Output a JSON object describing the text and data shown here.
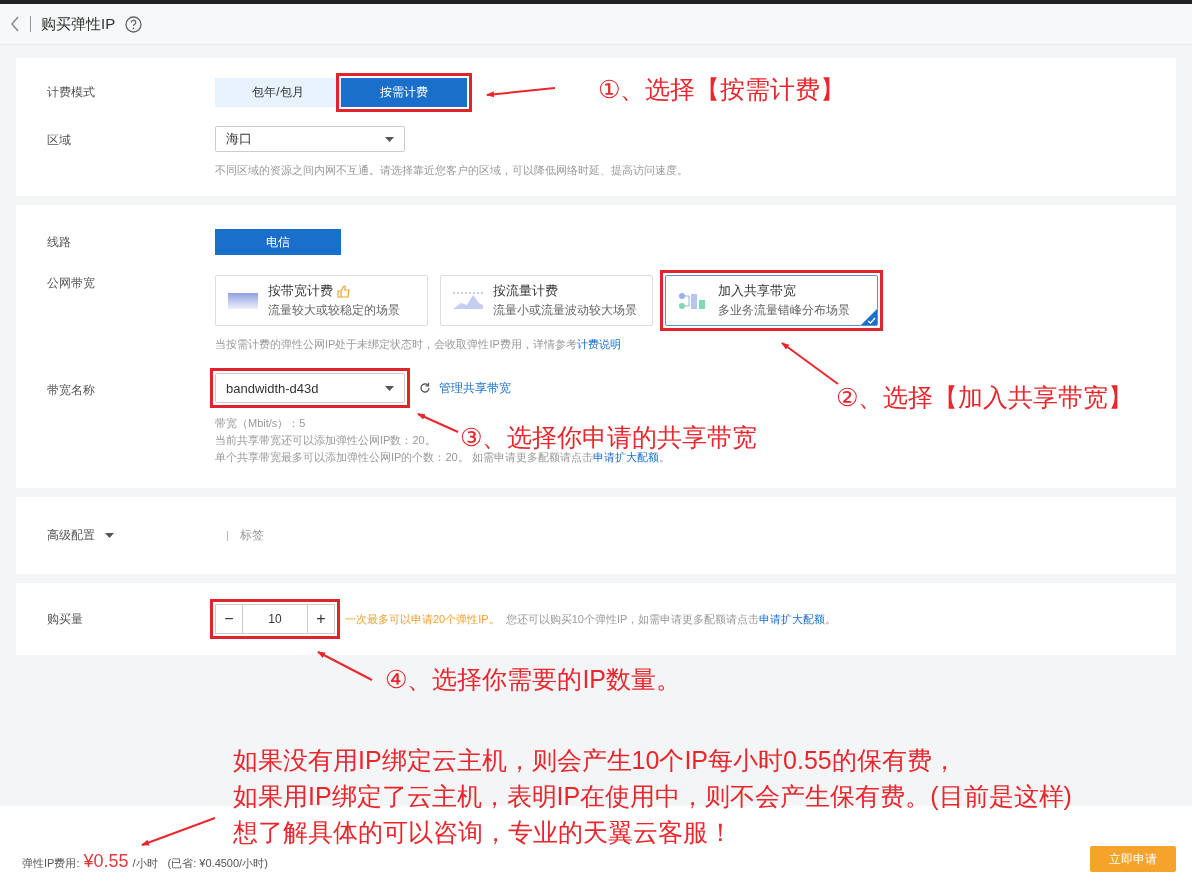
{
  "header": {
    "title": "购买弹性IP"
  },
  "billing": {
    "label": "计费模式",
    "options": [
      {
        "label": "包年/包月",
        "selected": false,
        "highlighted": false
      },
      {
        "label": "按需计费",
        "selected": true,
        "highlighted": true
      }
    ]
  },
  "region": {
    "label": "区域",
    "value": "海口",
    "hint": "不同区域的资源之间内网不互通。请选择靠近您客户的区域，可以降低网络时延、提高访问速度。"
  },
  "line": {
    "label": "线路",
    "options": [
      {
        "label": "电信",
        "selected": true
      }
    ]
  },
  "bandwidth": {
    "label": "公网带宽",
    "options": [
      {
        "kind": "fixed",
        "title": "按带宽计费",
        "subtitle": "流量较大或较稳定的场景",
        "recommended": true,
        "selected": false,
        "highlighted": false
      },
      {
        "kind": "traffic",
        "title": "按流量计费",
        "subtitle": "流量小或流量波动较大场景",
        "recommended": false,
        "selected": false,
        "highlighted": false
      },
      {
        "kind": "shared",
        "title": "加入共享带宽",
        "subtitle": "多业务流量错峰分布场景",
        "recommended": false,
        "selected": true,
        "highlighted": true
      }
    ],
    "hint": "当按需计费的弹性公网IP处于未绑定状态时，会收取弹性IP费用，详情参考",
    "hint_link": "计费说明"
  },
  "bandwidth_name": {
    "label": "带宽名称",
    "value": "bandwidth-d43d",
    "highlighted": true,
    "manage_link": "管理共享带宽",
    "info": [
      "带宽（Mbit/s）：5",
      "当前共享带宽还可以添加弹性公网IP数：20。"
    ],
    "quota_text": "单个共享带宽最多可以添加弹性公网IP的个数：20。 如需申请更多配额请点击",
    "quota_link": "申请扩大配额",
    "quota_end": "。"
  },
  "advanced": {
    "label": "高级配置",
    "tab": "标签"
  },
  "quantity": {
    "label": "购买量",
    "value": "10",
    "minus": "−",
    "plus": "+",
    "highlighted": true,
    "warning": "一次最多可以申请20个弹性IP。",
    "note": "您还可以购买10个弹性IP，如需申请更多配额请点击",
    "link": "申请扩大配额",
    "end": "。"
  },
  "footer": {
    "label": "弹性IP费用:",
    "price": "¥0.55",
    "unit": "/小时",
    "saved": "(已省: ¥0.4500/小时)",
    "button": "立即申请"
  },
  "annotations": [
    {
      "text": "①、选择【按需计费】"
    },
    {
      "text": "②、选择【加入共享带宽】"
    },
    {
      "text": "③、选择你申请的共享带宽"
    },
    {
      "text": "④、选择你需要的IP数量。"
    }
  ],
  "notes": [
    "如果没有用IP绑定云主机，则会产生10个IP每小时0.55的保有费，",
    "如果用IP绑定了云主机，表明IP在使用中，则不会产生保有费。(目前是这样)",
    "想了解具体的可以咨询，专业的天翼云客服！"
  ]
}
